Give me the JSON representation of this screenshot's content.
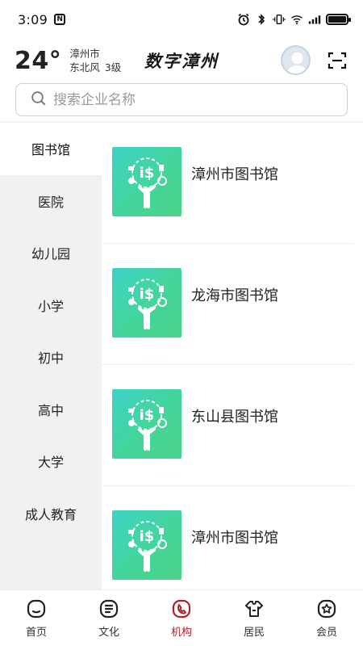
{
  "status_bar": {
    "time": "3:09",
    "nfc": "N"
  },
  "header": {
    "temperature": "24°",
    "city": "漳州市",
    "wind": "东北风",
    "wind_level": "3级",
    "app_title": "数字漳州"
  },
  "search": {
    "placeholder": "搜索企业名称",
    "value": ""
  },
  "sidebar": {
    "items": [
      {
        "label": "图书馆",
        "active": true
      },
      {
        "label": "医院"
      },
      {
        "label": "幼儿园"
      },
      {
        "label": "小学"
      },
      {
        "label": "初中"
      },
      {
        "label": "高中"
      },
      {
        "label": "大学"
      },
      {
        "label": "成人教育"
      }
    ]
  },
  "list": {
    "items": [
      {
        "title": "漳州市图书馆"
      },
      {
        "title": "龙海市图书馆"
      },
      {
        "title": "东山县图书馆"
      },
      {
        "title": "漳州市图书馆"
      }
    ]
  },
  "bottom_nav": {
    "items": [
      {
        "label": "首页",
        "icon": "home-icon"
      },
      {
        "label": "文化",
        "icon": "culture-icon"
      },
      {
        "label": "机构",
        "icon": "institution-icon",
        "active": true
      },
      {
        "label": "居民",
        "icon": "residents-icon"
      },
      {
        "label": "会员",
        "icon": "member-icon"
      }
    ]
  },
  "colors": {
    "accent": "#b3202b",
    "thumb_start": "#3dd3c6",
    "thumb_end": "#4cd38a",
    "sidebar_bg": "#f1f1f1"
  }
}
